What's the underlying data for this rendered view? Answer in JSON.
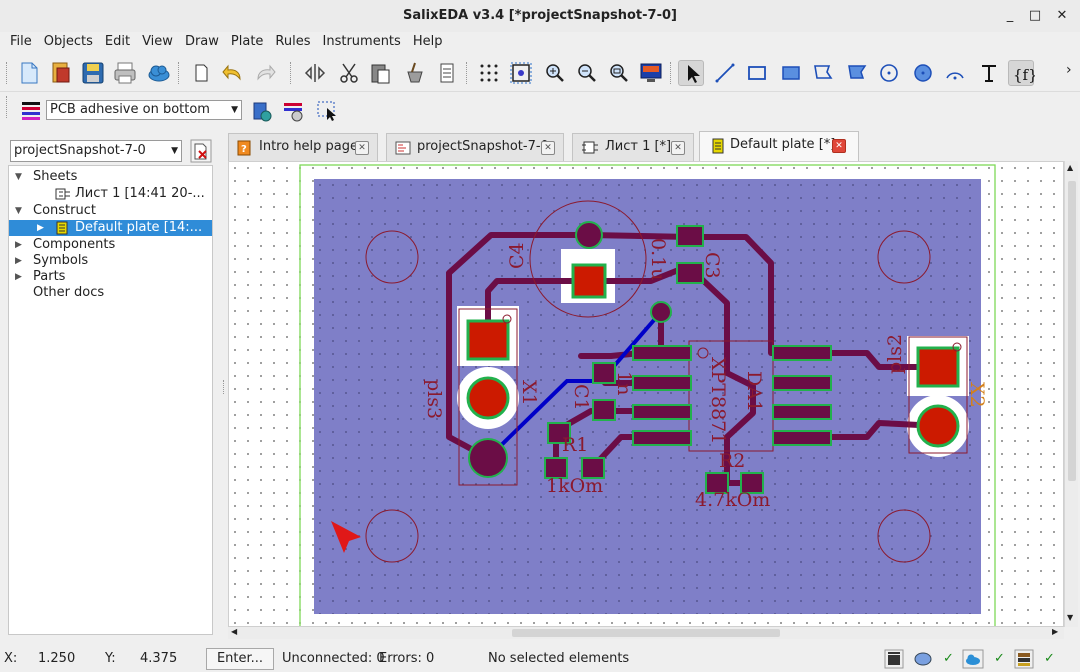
{
  "window": {
    "title": "SalixEDA v3.4 [*projectSnapshot-7-0]",
    "minimize": "_",
    "maximize": "□",
    "close": "✕"
  },
  "menu": [
    "File",
    "Objects",
    "Edit",
    "View",
    "Draw",
    "Plate",
    "Rules",
    "Instruments",
    "Help"
  ],
  "toolbar1": {
    "icons": [
      "new-file",
      "open-file",
      "save",
      "print",
      "cloud",
      "new-page",
      "undo",
      "redo",
      "flip",
      "cut",
      "paste",
      "clean",
      "list",
      "grid",
      "zoom-fit",
      "zoom-in",
      "zoom-out",
      "zoom-window",
      "monitor",
      "select",
      "line",
      "rect",
      "filled-rect",
      "polygon",
      "filled-polygon",
      "circle",
      "filled-circle",
      "arc",
      "text",
      "field"
    ],
    "overflow": "›"
  },
  "toolbar2": {
    "layer_select": "PCB adhesive on bottom"
  },
  "left": {
    "project_select": "projectSnapshot-7-0",
    "tree": {
      "sheets": "Sheets",
      "sheet1": "Лист 1 [14:41 20-...",
      "construct": "Construct",
      "plate": "Default plate [14:...",
      "components": "Components",
      "symbols": "Symbols",
      "parts": "Parts",
      "other": "Other docs"
    }
  },
  "tabs": [
    {
      "label": "Intro help page",
      "active": false
    },
    {
      "label": "projectSnapshot-7-0",
      "active": false
    },
    {
      "label": "Лист 1 [*]",
      "active": false
    },
    {
      "label": "Default plate [*]",
      "active": true
    }
  ],
  "pcb": {
    "colors": {
      "board": "#7f7fc8",
      "trace": "#6b0d46",
      "pad": "#cc1a00",
      "pad_outline": "#22b14c",
      "silk": "#8b1a2e",
      "route": "#0000c8",
      "keepout": "#ffffff"
    },
    "labels": {
      "c4": "C4",
      "c3": "C3",
      "c3_val": "0.1u",
      "c1": "C1",
      "c1_val": "1n",
      "r1": "R1",
      "r1_val": "1kOm",
      "r2": "R2",
      "r2_val": "4.7kOm",
      "da1": "DA1",
      "da1_val": "XPT8871",
      "x1": "X1",
      "x1_val": "pls3",
      "x2": "X2",
      "x2_val": "pls2"
    }
  },
  "status": {
    "x_label": "X:",
    "x_val": "1.250",
    "y_label": "Y:",
    "y_val": "4.375",
    "enter_btn": "Enter...",
    "unconnected": "Unconnected: 0",
    "errors": "Errors: 0",
    "selection": "No selected elements",
    "checks": [
      "✓",
      "✓",
      "✓"
    ]
  }
}
